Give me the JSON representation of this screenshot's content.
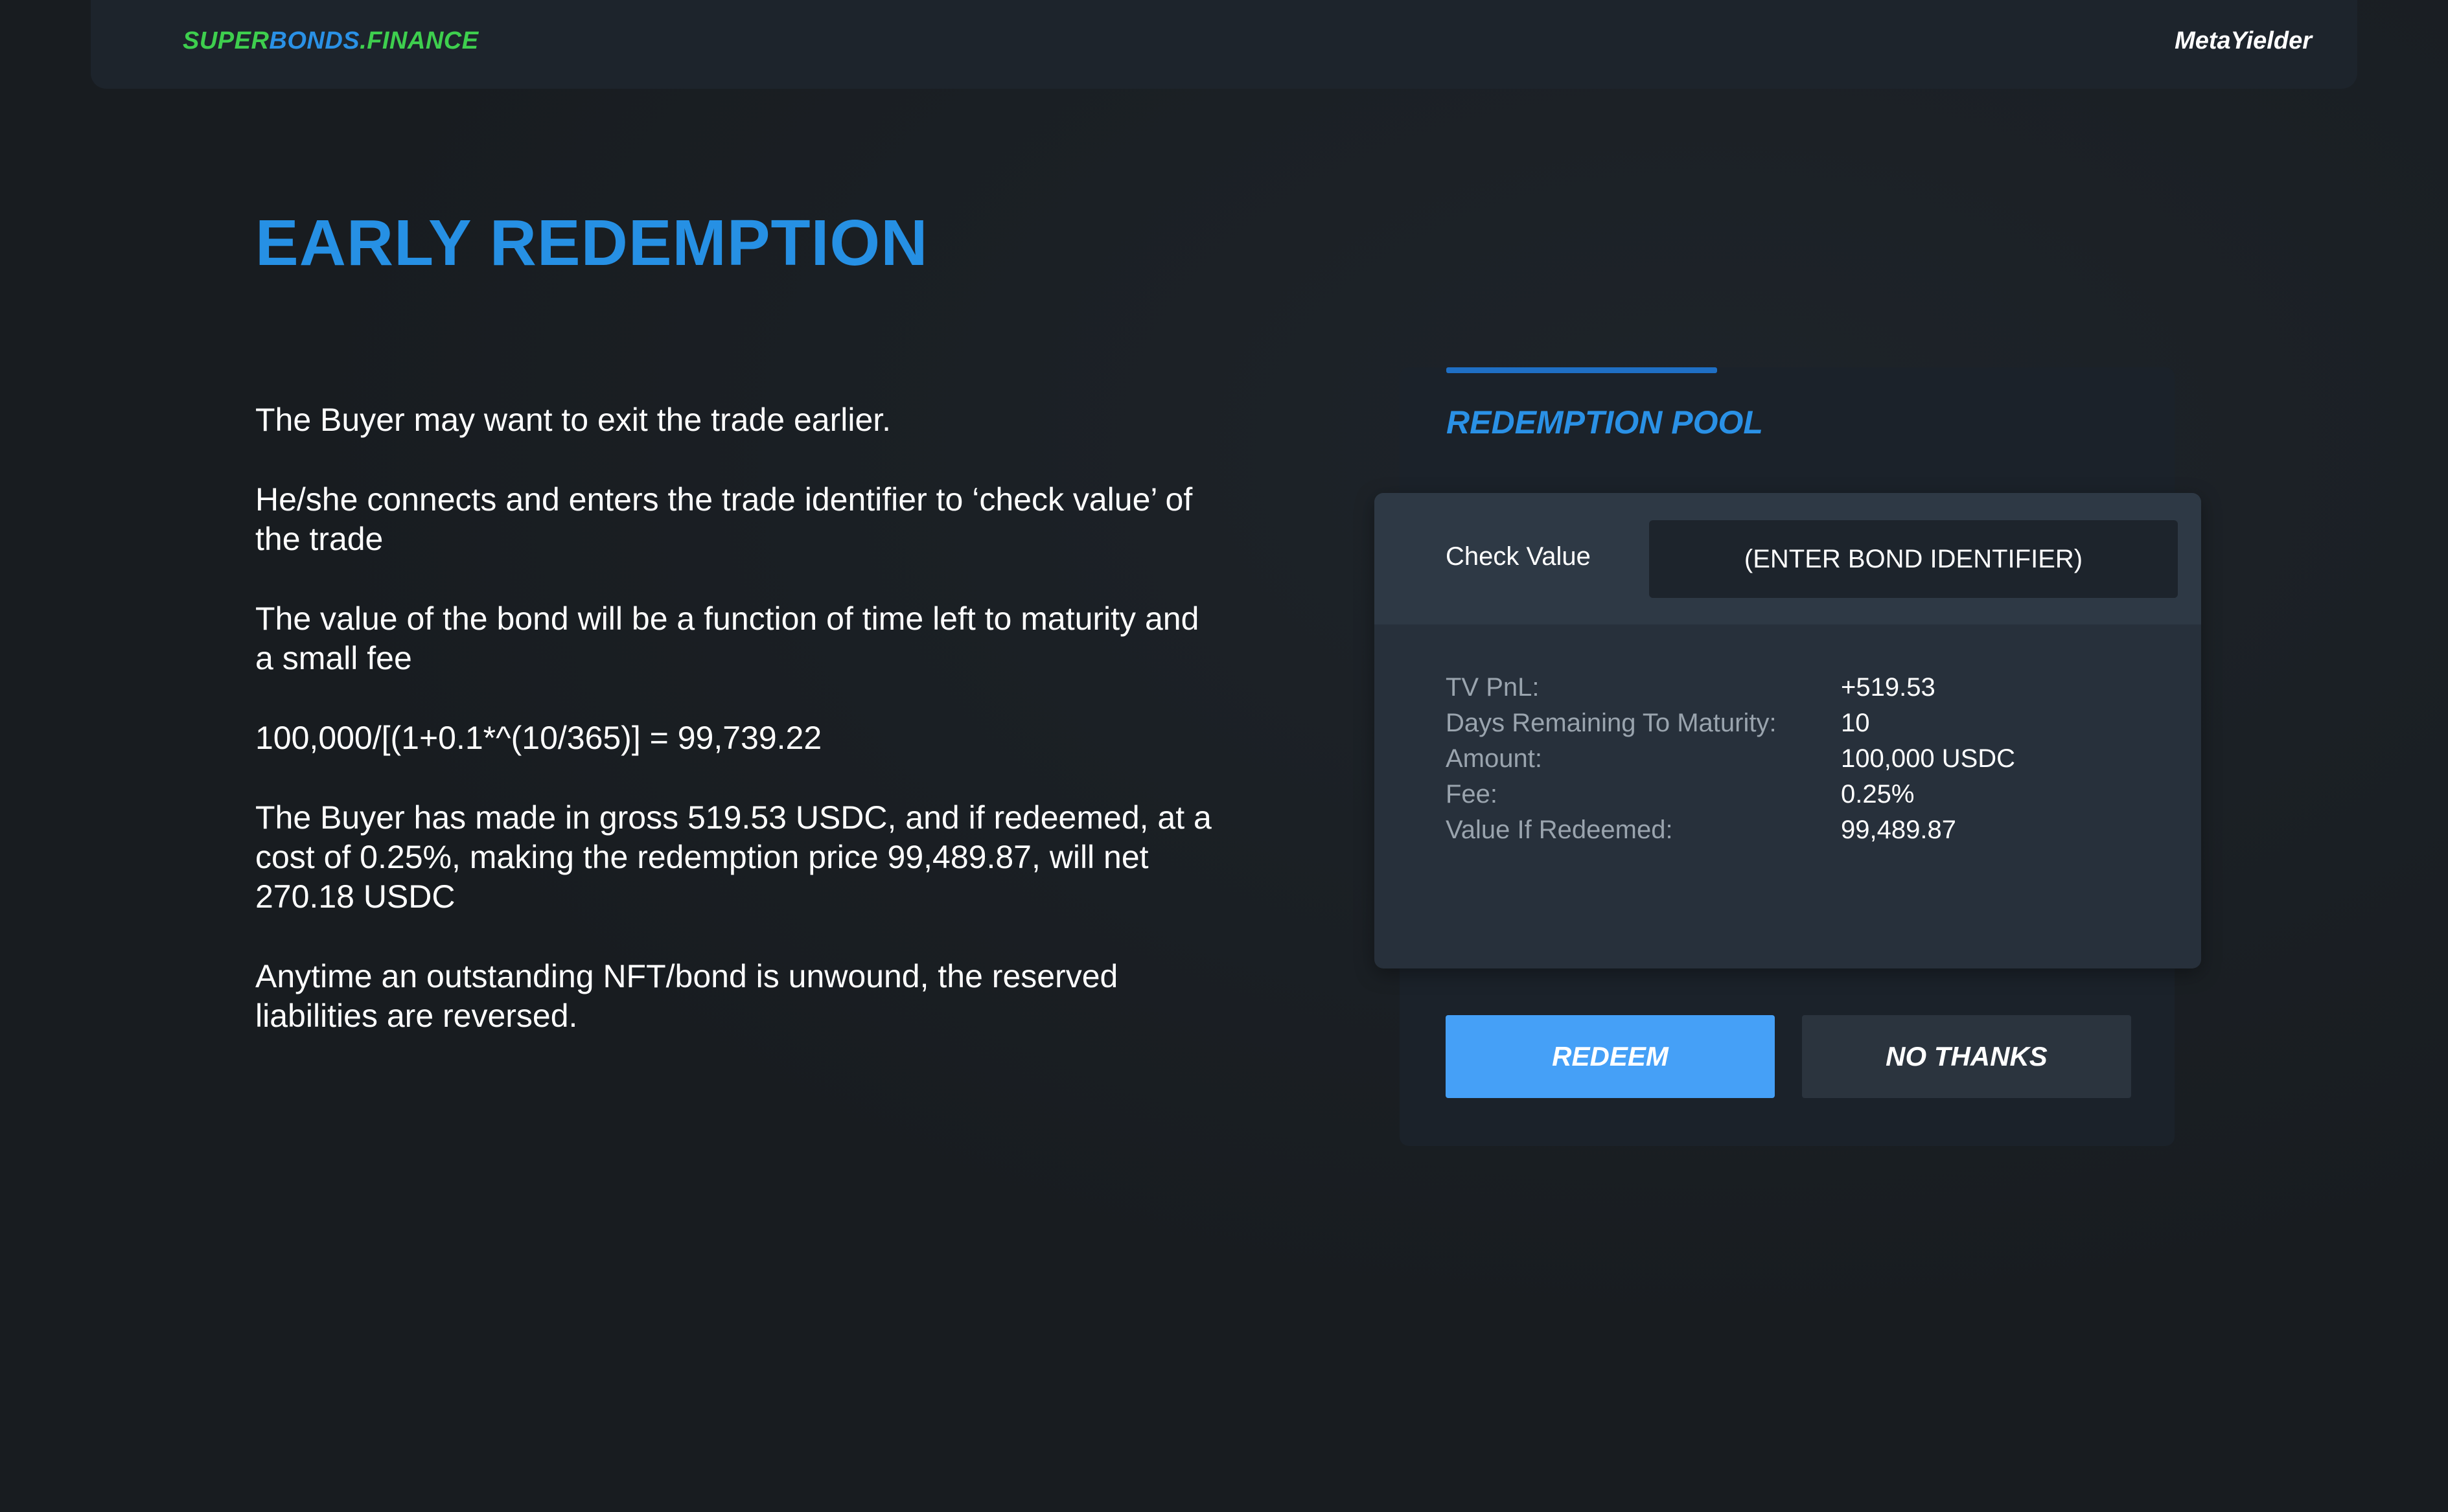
{
  "header": {
    "brand": {
      "part1": "SUPER",
      "part2": "BONDS",
      "part3": ".FINANCE"
    },
    "user_name": "MetaYielder"
  },
  "page_title": "EARLY REDEMPTION",
  "paragraphs": [
    "The Buyer may want to exit the trade earlier.",
    "He/she connects and enters the trade identifier to ‘check value’ of the trade",
    "The value of the bond will be a function of time left to maturity and a small fee",
    "100,000/[(1+0.1*^(10/365)] = 99,739.22",
    "The Buyer has made in gross 519.53 USDC, and if redeemed, at a cost of 0.25%, making the redemption price 99,489.87, will net 270.18 USDC",
    "Anytime an outstanding NFT/bond is unwound, the reserved liabilities are reversed."
  ],
  "pool": {
    "title": "REDEMPTION POOL",
    "check_label": "Check Value",
    "input_placeholder": "(ENTER BOND IDENTIFIER)",
    "stats": [
      {
        "label": "TV PnL:",
        "value": "+519.53"
      },
      {
        "label": "Days Remaining To Maturity:",
        "value": "10"
      },
      {
        "label": "Amount:",
        "value": "100,000 USDC"
      },
      {
        "label": "Fee:",
        "value": "0.25%"
      },
      {
        "label": "Value If Redeemed:",
        "value": "99,489.87"
      }
    ],
    "redeem_label": "REDEEM",
    "no_thanks_label": "NO THANKS"
  },
  "colors": {
    "background": "#181c20",
    "accent_blue": "#2690e4",
    "brand_green": "#3ecf4e",
    "button_blue": "#45a0f7"
  }
}
